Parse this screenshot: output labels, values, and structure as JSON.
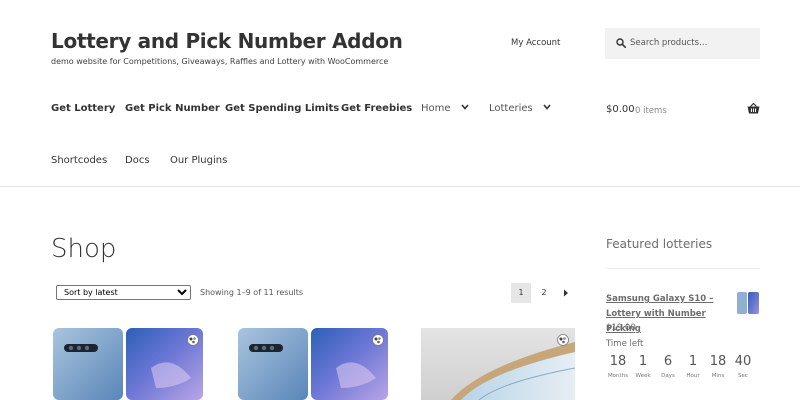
{
  "site": {
    "title": "Lottery and Pick Number Addon",
    "description": "demo website for Competitions, Giveaways, Raffles and Lottery with WooCommerce"
  },
  "header": {
    "my_account": "My Account",
    "search_placeholder": "Search products…"
  },
  "nav": {
    "items": [
      {
        "label": "Get Lottery"
      },
      {
        "label": "Get Pick Number"
      },
      {
        "label": "Get Spending Limits"
      },
      {
        "label": "Get Freebies"
      },
      {
        "label": "Home"
      },
      {
        "label": "Lotteries"
      },
      {
        "label": "Shortcodes"
      },
      {
        "label": "Docs"
      },
      {
        "label": "Our Plugins"
      }
    ]
  },
  "cart": {
    "amount": "$0.00",
    "count": "0 items"
  },
  "shop": {
    "title": "Shop",
    "sort_selected": "Sort by latest",
    "sort_options": [
      "Sort by latest"
    ],
    "showing": "Showing 1–9 of 11 results",
    "pages": [
      "1",
      "2"
    ],
    "current_page": "1"
  },
  "sidebar": {
    "title": "Featured lotteries",
    "item": {
      "name": "Samsung Galaxy S10 – Lottery with Number Picking",
      "price": "$19.00",
      "time_left_label": "Time left",
      "countdown": [
        {
          "value": "18",
          "label": "Months"
        },
        {
          "value": "1",
          "label": "Week"
        },
        {
          "value": "6",
          "label": "Days"
        },
        {
          "value": "1",
          "label": "Hour"
        },
        {
          "value": "18",
          "label": "Mins"
        },
        {
          "value": "40",
          "label": "Sec"
        }
      ]
    }
  },
  "colors": {
    "accent_blue": "#2f6fc4",
    "text": "#333333",
    "muted": "#6d6d6d"
  }
}
